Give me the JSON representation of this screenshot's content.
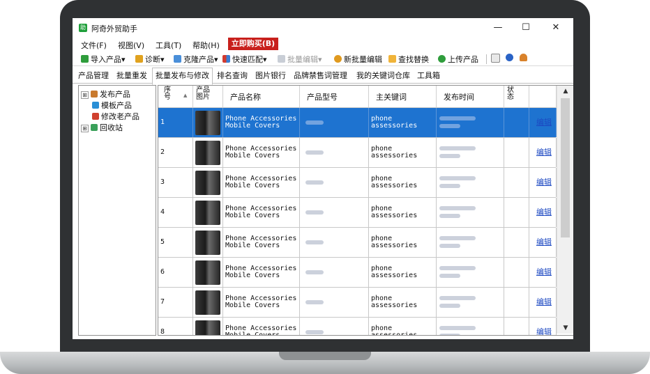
{
  "app": {
    "title": "阿奇外贸助手",
    "icon_text": "助",
    "brand_color": "#1f9f3a"
  },
  "window_controls": {
    "minimize": "—",
    "maximize": "☐",
    "close": "✕"
  },
  "menu": {
    "items": [
      "文件(F)",
      "视图(V)",
      "工具(T)",
      "帮助(H)"
    ],
    "buy": "立即购买(B)"
  },
  "toolbar": {
    "import": "导入产品",
    "diagnose": "诊断",
    "clone": "克隆产品",
    "quick_match": "快速匹配",
    "batch_edit": "批量编辑",
    "new_batch_edit": "新批量编辑",
    "find_replace": "查找替换",
    "upload": "上传产品",
    "dropdown": "▾"
  },
  "tabs": [
    "产品管理",
    "批量重发",
    "批量发布与修改",
    "排名查询",
    "图片银行",
    "品牌禁售词管理",
    "我的关键词仓库",
    "工具箱"
  ],
  "active_tab_index": 2,
  "tree": {
    "items": [
      {
        "label": "发布产品",
        "expander": "⊞"
      },
      {
        "label": "模板产品"
      },
      {
        "label": "修改老产品"
      },
      {
        "label": "回收站",
        "expander": "⊞"
      }
    ]
  },
  "grid": {
    "columns": {
      "seq": "序号",
      "image": "产品图片",
      "name": "产品名称",
      "model": "产品型号",
      "keyword": "主关键词",
      "time": "发布时间",
      "status": "状态"
    },
    "sort_indicator": "▲",
    "edit_label": "编辑",
    "rows": [
      {
        "no": "1",
        "name": "Phone Accessories\nMobile Covers",
        "keyword": "phone\nassessories",
        "selected": true
      },
      {
        "no": "2",
        "name": "Phone Accessories\nMobile Covers",
        "keyword": "phone\nassessories"
      },
      {
        "no": "3",
        "name": "Phone Accessories\nMobile Covers",
        "keyword": "phone\nassessories"
      },
      {
        "no": "4",
        "name": "Phone Accessories\nMobile Covers",
        "keyword": "phone\nassessories"
      },
      {
        "no": "5",
        "name": "Phone Accessories\nMobile Covers",
        "keyword": "phone\nassessories"
      },
      {
        "no": "6",
        "name": "Phone Accessories\nMobile Covers",
        "keyword": "phone\nassessories"
      },
      {
        "no": "7",
        "name": "Phone Accessories\nMobile Covers",
        "keyword": "phone\nassessories"
      },
      {
        "no": "8",
        "name": "Phone Accessories\nMobile Covers",
        "keyword": "phone\nassessories"
      }
    ]
  },
  "scroll": {
    "up": "▲",
    "down": "▼"
  }
}
